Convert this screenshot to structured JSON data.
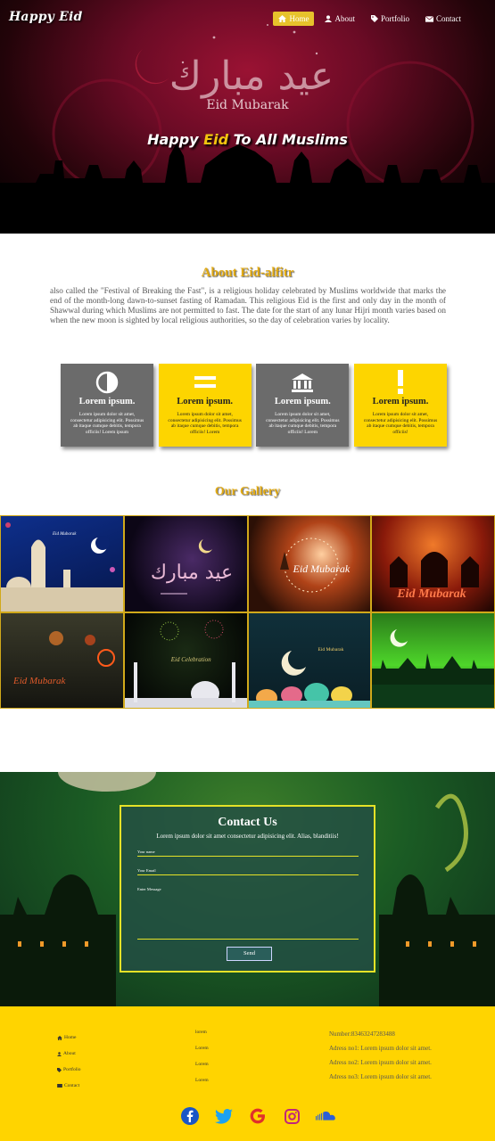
{
  "nav": {
    "brand": "Happy Eid",
    "items": [
      {
        "label": "Home",
        "icon": "home-icon",
        "active": true
      },
      {
        "label": "About",
        "icon": "user-icon",
        "active": false
      },
      {
        "label": "Portfolio",
        "icon": "tag-icon",
        "active": false
      },
      {
        "label": "Contact",
        "icon": "envelope-icon",
        "active": false
      }
    ]
  },
  "hero": {
    "mubarak": "Eid Mubarak",
    "title_before": "Happy ",
    "title_highlight": "Eid",
    "title_after": " To All Muslims"
  },
  "about": {
    "title": "About Eid-alfitr",
    "text": "also called the \"Festival of Breaking the Fast\", is a religious holiday celebrated by Muslims worldwide that marks the end of the month-long dawn-to-sunset fasting of Ramadan. This religious Eid is the first and only day in the month of Shawwal during which Muslims are not permitted to fast. The date for the start of any lunar Hijri month varies based on when the new moon is sighted by local religious authorities, so the day of celebration varies by locality."
  },
  "cards": [
    {
      "title": "Lorem ipsum.",
      "text": "Lorem ipsum dolor sit amet, consectetur adipisicing elit. Possimus ab itaque cumque debitis, tempora officiis! Lorem ipsum",
      "style": "gray",
      "icon": "half-circle-icon"
    },
    {
      "title": "Lorem ipsum.",
      "text": "Lorem ipsum dolor sit amet, consectetur adipisicing elit. Possimus ab itaque cumque debitis, tempora officiis! Lorem",
      "style": "yellow",
      "icon": "equals-icon"
    },
    {
      "title": "Lorem ipsum.",
      "text": "Lorem ipsum dolor sit amet, consectetur adipisicing elit. Possimus ab itaque cumque debitis, tempora officiis! Lorem",
      "style": "gray",
      "icon": "building-icon"
    },
    {
      "title": "Lorem ipsum.",
      "text": "Lorem ipsum dolor sit amet, consectetur adipisicing elit. Possimus ab itaque cumque debitis, tempora officiis!",
      "style": "yellow",
      "icon": "exclamation-icon"
    }
  ],
  "gallery": {
    "title": "Our Gallery",
    "tiles": [
      {
        "caption": "Eid Mubarak"
      },
      {
        "caption": ""
      },
      {
        "caption": "Eid Mubarak"
      },
      {
        "caption": "Eid Mubarak"
      },
      {
        "caption": "Eid Mubarak"
      },
      {
        "caption": "Eid Celebration"
      },
      {
        "caption": "Eid Mubarak"
      },
      {
        "caption": ""
      }
    ]
  },
  "contact": {
    "title": "Contact Us",
    "subtitle": "Lorem ipsum dolor sit amet consectetur adipisicing elit. Alias, blanditiis!",
    "name_placeholder": "Your name",
    "email_placeholder": "Your Email",
    "message_placeholder": "Enter Message",
    "send_label": "Send"
  },
  "footer": {
    "links": [
      {
        "label": "Home",
        "icon": "home-icon"
      },
      {
        "label": "About",
        "icon": "user-icon"
      },
      {
        "label": "Portfolio",
        "icon": "tag-icon"
      },
      {
        "label": "Contact",
        "icon": "envelope-icon"
      }
    ],
    "col2": [
      "lorem",
      "Lorem",
      "Lorem",
      "Lorem"
    ],
    "info": [
      "Number:83463247283488",
      "Adress no1: Lorem ipsum dolor sit amet.",
      "Adress no2: Lorem ipsum dolor sit amet.",
      "Adress no3: Lorem ipsum dolor sit amet."
    ],
    "socials": [
      {
        "name": "facebook-icon",
        "color": "#1a56c6"
      },
      {
        "name": "twitter-icon",
        "color": "#1da1f2"
      },
      {
        "name": "google-icon",
        "color": "#e0312b"
      },
      {
        "name": "instagram-icon",
        "color": "#c0267a"
      },
      {
        "name": "soundcloud-icon",
        "color": "#2b5fd6"
      }
    ]
  },
  "colors": {
    "accent_gold": "#e0a913",
    "nav_active": "#e7c22b",
    "card_gray": "#6b6b6b",
    "card_yellow": "#fdd500",
    "footer_bg": "#ffd400",
    "contact_border": "#e5e227"
  }
}
